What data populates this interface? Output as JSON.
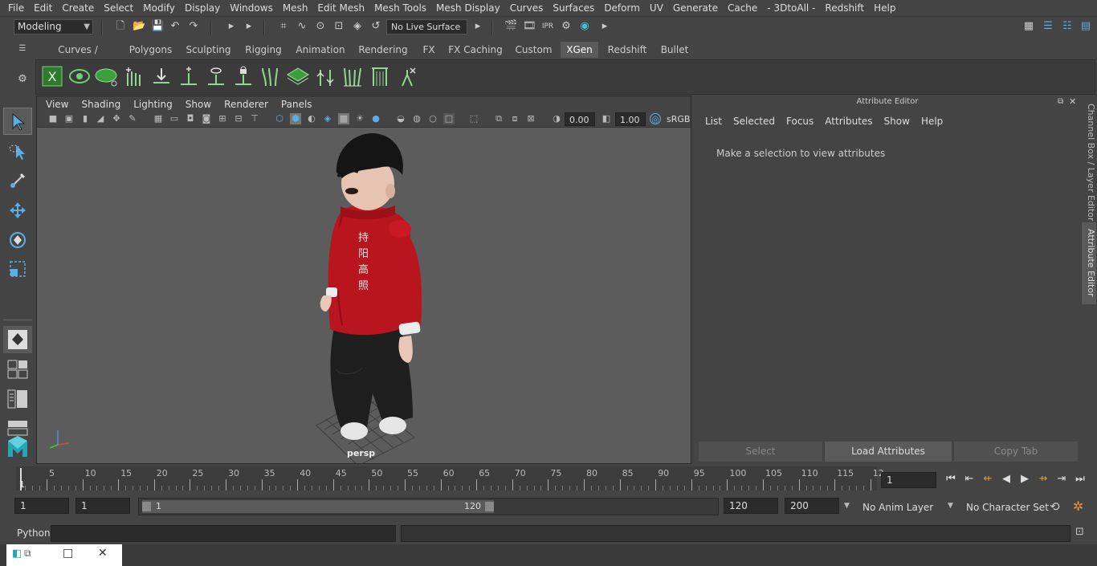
{
  "menubar": [
    "File",
    "Edit",
    "Create",
    "Select",
    "Modify",
    "Display",
    "Windows",
    "Mesh",
    "Edit Mesh",
    "Mesh Tools",
    "Mesh Display",
    "Curves",
    "Surfaces",
    "Deform",
    "UV",
    "Generate",
    "Cache",
    "- 3DtoAll -",
    "Redshift",
    "Help"
  ],
  "status": {
    "mode": "Modeling",
    "live_surface": "No Live Surface"
  },
  "shelf": {
    "tabs": [
      "Curves / Surfaces",
      "Polygons",
      "Sculpting",
      "Rigging",
      "Animation",
      "Rendering",
      "FX",
      "FX Caching",
      "Custom",
      "XGen",
      "Redshift",
      "Bullet"
    ],
    "active_tab": "XGen",
    "icons": [
      "xgen-description-icon",
      "xgen-editor-icon",
      "create-description-icon",
      "add-guide-icon",
      "place-guide-icon",
      "add-guides-icon",
      "sculpt-guides-icon",
      "lock-guides-icon",
      "convert-guides-icon",
      "grid-icon",
      "bake-guides-icon",
      "interactive-groom-icon",
      "groom-editor-icon",
      "xgen-clumping-icon"
    ]
  },
  "viewport": {
    "menu": [
      "View",
      "Shading",
      "Lighting",
      "Show",
      "Renderer",
      "Panels"
    ],
    "exposure": "0.00",
    "gamma": "1.00",
    "colorspace": "sRGB",
    "camera_label": "persp",
    "character_text": "持 阳 高 照"
  },
  "attribute_editor": {
    "title": "Attribute Editor",
    "menu": [
      "List",
      "Selected",
      "Focus",
      "Attributes",
      "Show",
      "Help"
    ],
    "message": "Make a selection to view attributes",
    "buttons": {
      "select": "Select",
      "load": "Load Attributes",
      "copy": "Copy Tab"
    }
  },
  "side_tabs": {
    "channel_box": "Channel Box / Layer Editor",
    "attribute_editor": "Attribute Editor"
  },
  "timeline": {
    "ticks": [
      "5",
      "10",
      "15",
      "20",
      "25",
      "30",
      "35",
      "40",
      "45",
      "50",
      "55",
      "60",
      "65",
      "70",
      "75",
      "80",
      "85",
      "90",
      "95",
      "100",
      "105",
      "110",
      "115",
      "12"
    ],
    "start_marker": "1",
    "current_frame": "1"
  },
  "range": {
    "start": "1",
    "playback_start": "1",
    "slider_start": "1",
    "slider_end": "120",
    "playback_end": "120",
    "end": "200",
    "anim_layer": "No Anim Layer",
    "character_set": "No Character Set"
  },
  "cmdline": {
    "label": "Python"
  }
}
